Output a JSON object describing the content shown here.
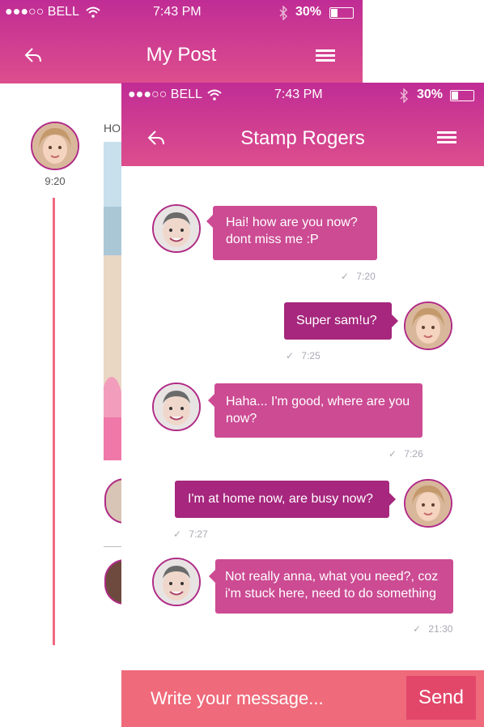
{
  "colors": {
    "bar_top": "#c02c95",
    "bar_bottom": "#dd4e8d",
    "bubble_in": "#cc4b93",
    "bubble_out": "#a6277d",
    "composer": "#ef6a7b",
    "send": "#e2476a",
    "timeline": "#f06880"
  },
  "back_screen": {
    "status": {
      "signal": "●●●○○",
      "carrier": "BELL",
      "time": "7:43 PM",
      "battery": "30%"
    },
    "title": "My Post",
    "post": {
      "time": "9:20",
      "label_partial": "HO"
    }
  },
  "front_screen": {
    "status": {
      "signal": "●●●○○",
      "carrier": "BELL",
      "time": "7:43 PM",
      "battery": "30%"
    },
    "title": "Stamp Rogers",
    "messages": [
      {
        "text_line1": "Hai! how are you now?",
        "text_line2": "dont miss me :P",
        "time": "7:20"
      },
      {
        "text_line1": "Super sam!u?",
        "time": "7:25"
      },
      {
        "text_line1": "Haha... I'm good, where are you",
        "text_line2": "now?",
        "time": "7:26"
      },
      {
        "text_line1": "I'm at home now, are busy now?",
        "time": "7:27"
      },
      {
        "text_line1": "Not really anna, what you need?, coz",
        "text_line2": "i'm stuck here, need to do something",
        "time": "21:30"
      }
    ],
    "composer": {
      "placeholder": "Write your message...",
      "send_label": "Send"
    }
  },
  "icons": {
    "reply": "reply-arrow-icon",
    "menu": "hamburger-menu-icon",
    "wifi": "wifi-icon",
    "bluetooth": "bluetooth-icon",
    "battery": "battery-icon",
    "check": "check-icon"
  }
}
